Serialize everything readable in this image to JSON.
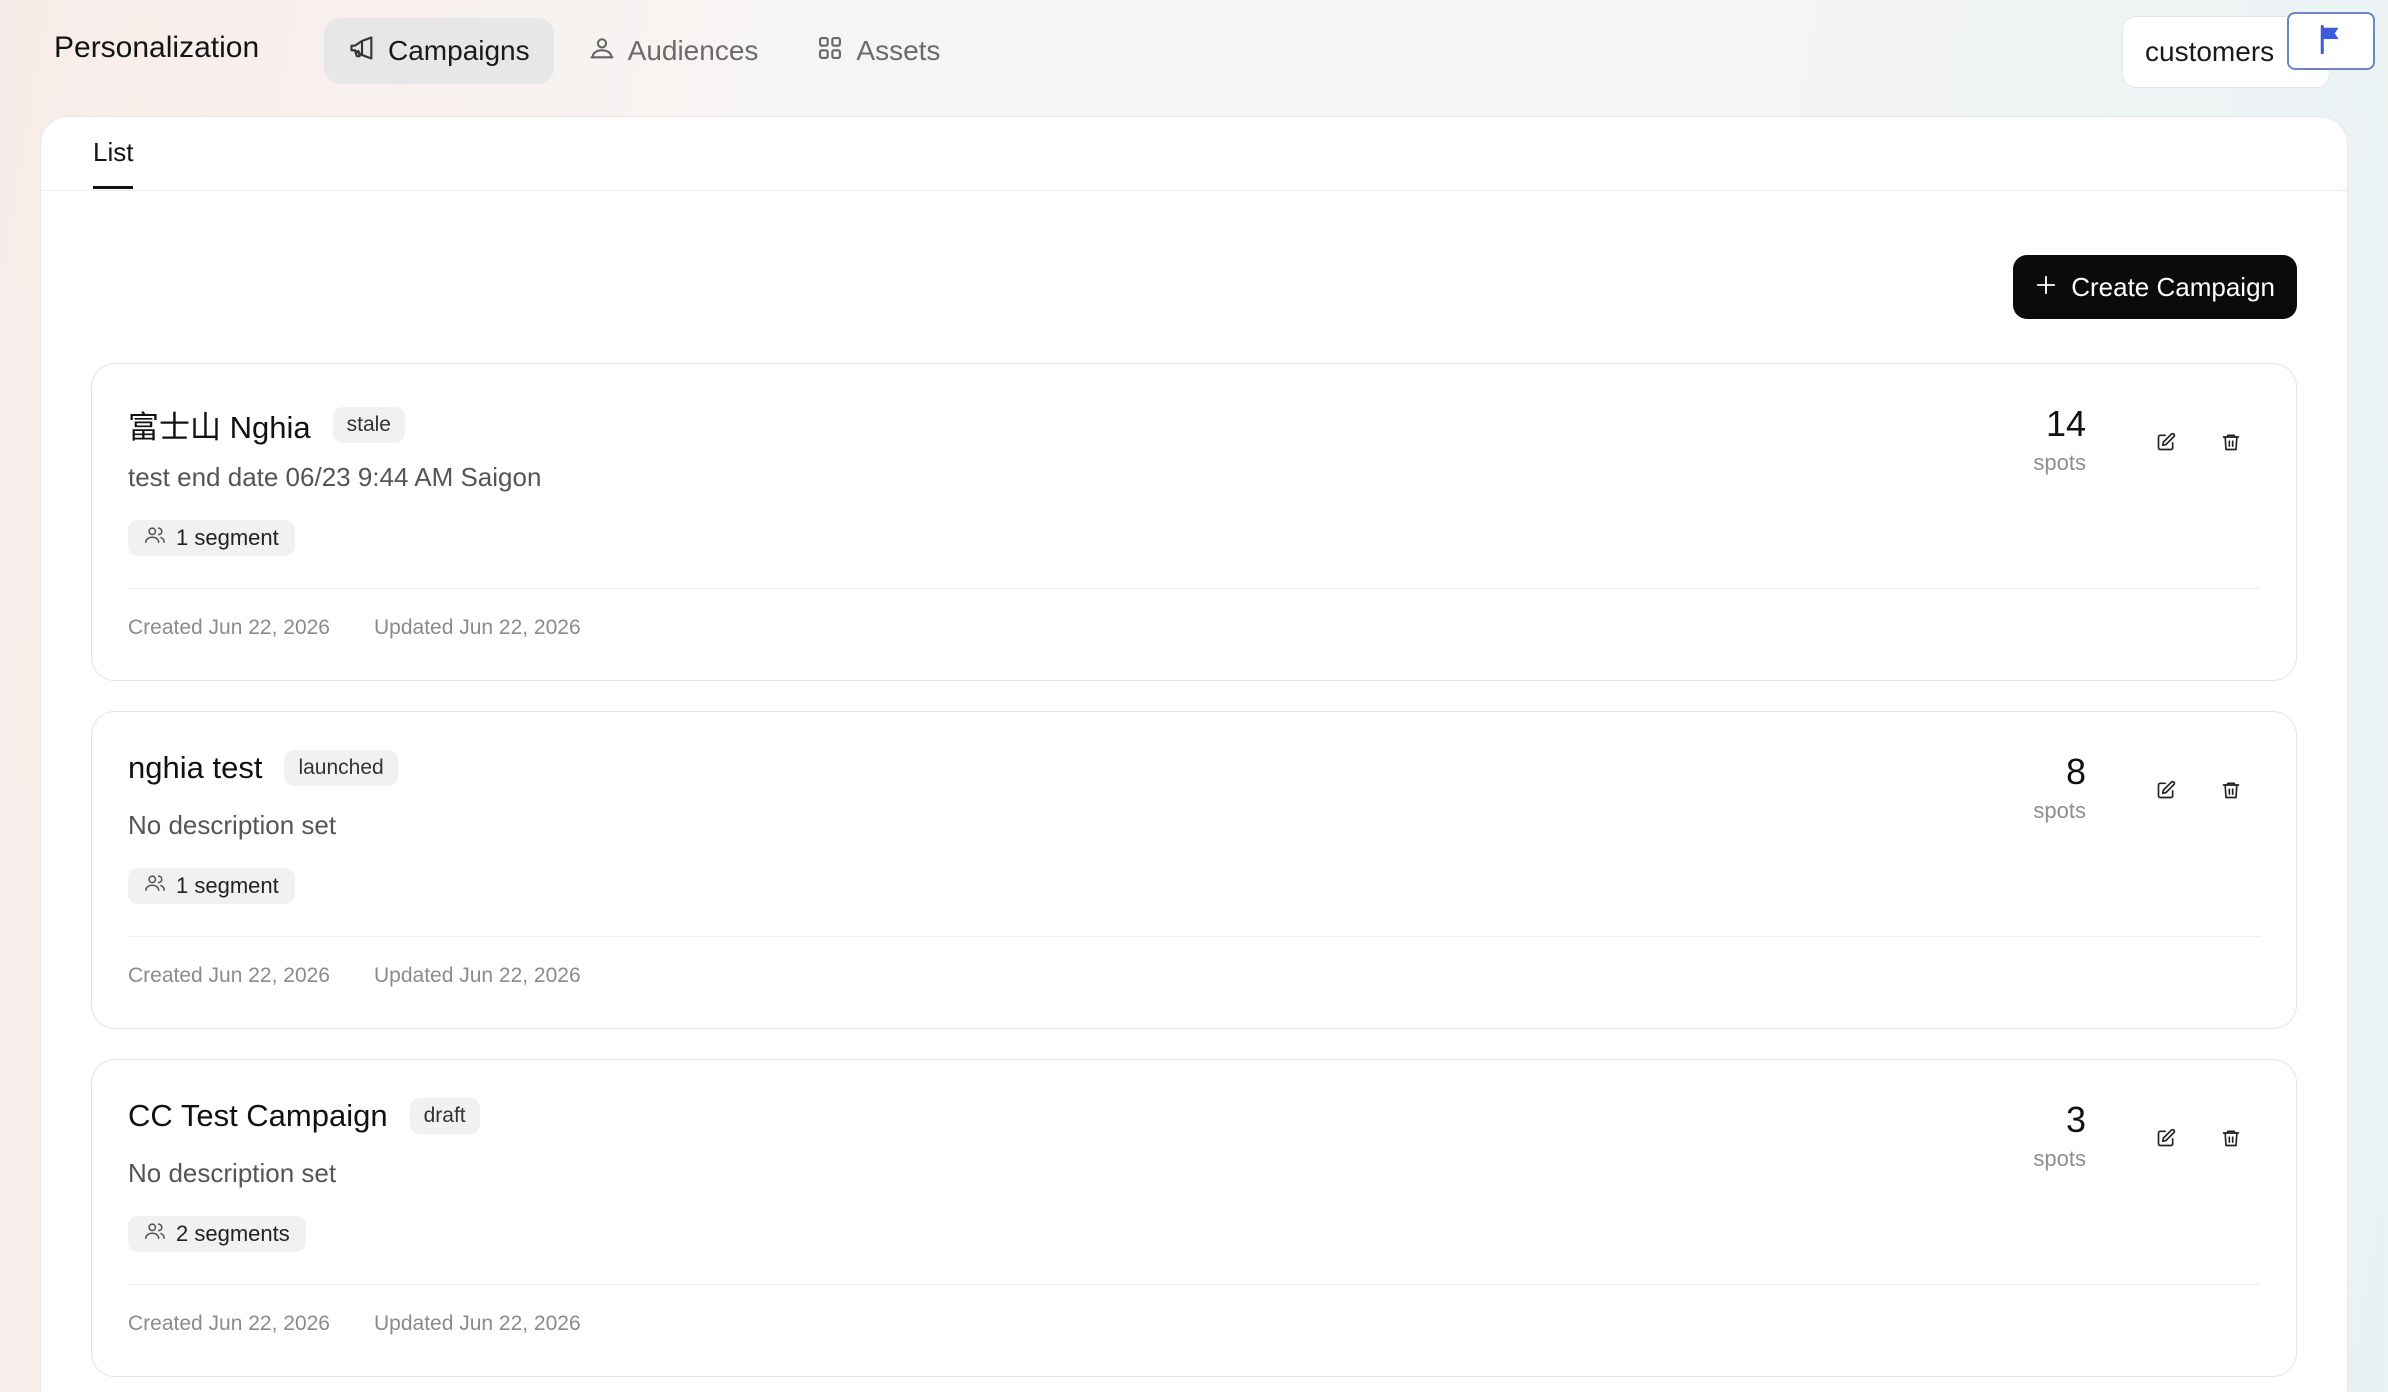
{
  "app": {
    "title": "Personalization"
  },
  "nav": {
    "tabs": [
      {
        "label": "Campaigns",
        "icon": "megaphone-icon",
        "active": true
      },
      {
        "label": "Audiences",
        "icon": "users-icon",
        "active": false
      },
      {
        "label": "Assets",
        "icon": "grid-icon",
        "active": false
      }
    ]
  },
  "workspace": {
    "label": "customers",
    "flag_icon": "flag-icon",
    "flag_color": "#3b5bdb"
  },
  "subtabs": {
    "list_label": "List"
  },
  "toolbar": {
    "create_label": "Create Campaign"
  },
  "campaigns": [
    {
      "title": "富士山 Nghia",
      "status": "stale",
      "description": "test end date 06/23 9:44 AM Saigon",
      "segments": "1 segment",
      "spots": "14",
      "spots_label": "spots",
      "created": "Created Jun 22, 2026",
      "updated": "Updated Jun 22, 2026"
    },
    {
      "title": "nghia test",
      "status": "launched",
      "description": "No description set",
      "segments": "1 segment",
      "spots": "8",
      "spots_label": "spots",
      "created": "Created Jun 22, 2026",
      "updated": "Updated Jun 22, 2026"
    },
    {
      "title": "CC Test Campaign",
      "status": "draft",
      "description": "No description set",
      "segments": "2 segments",
      "spots": "3",
      "spots_label": "spots",
      "created": "Created Jun 22, 2026",
      "updated": "Updated Jun 22, 2026"
    }
  ]
}
